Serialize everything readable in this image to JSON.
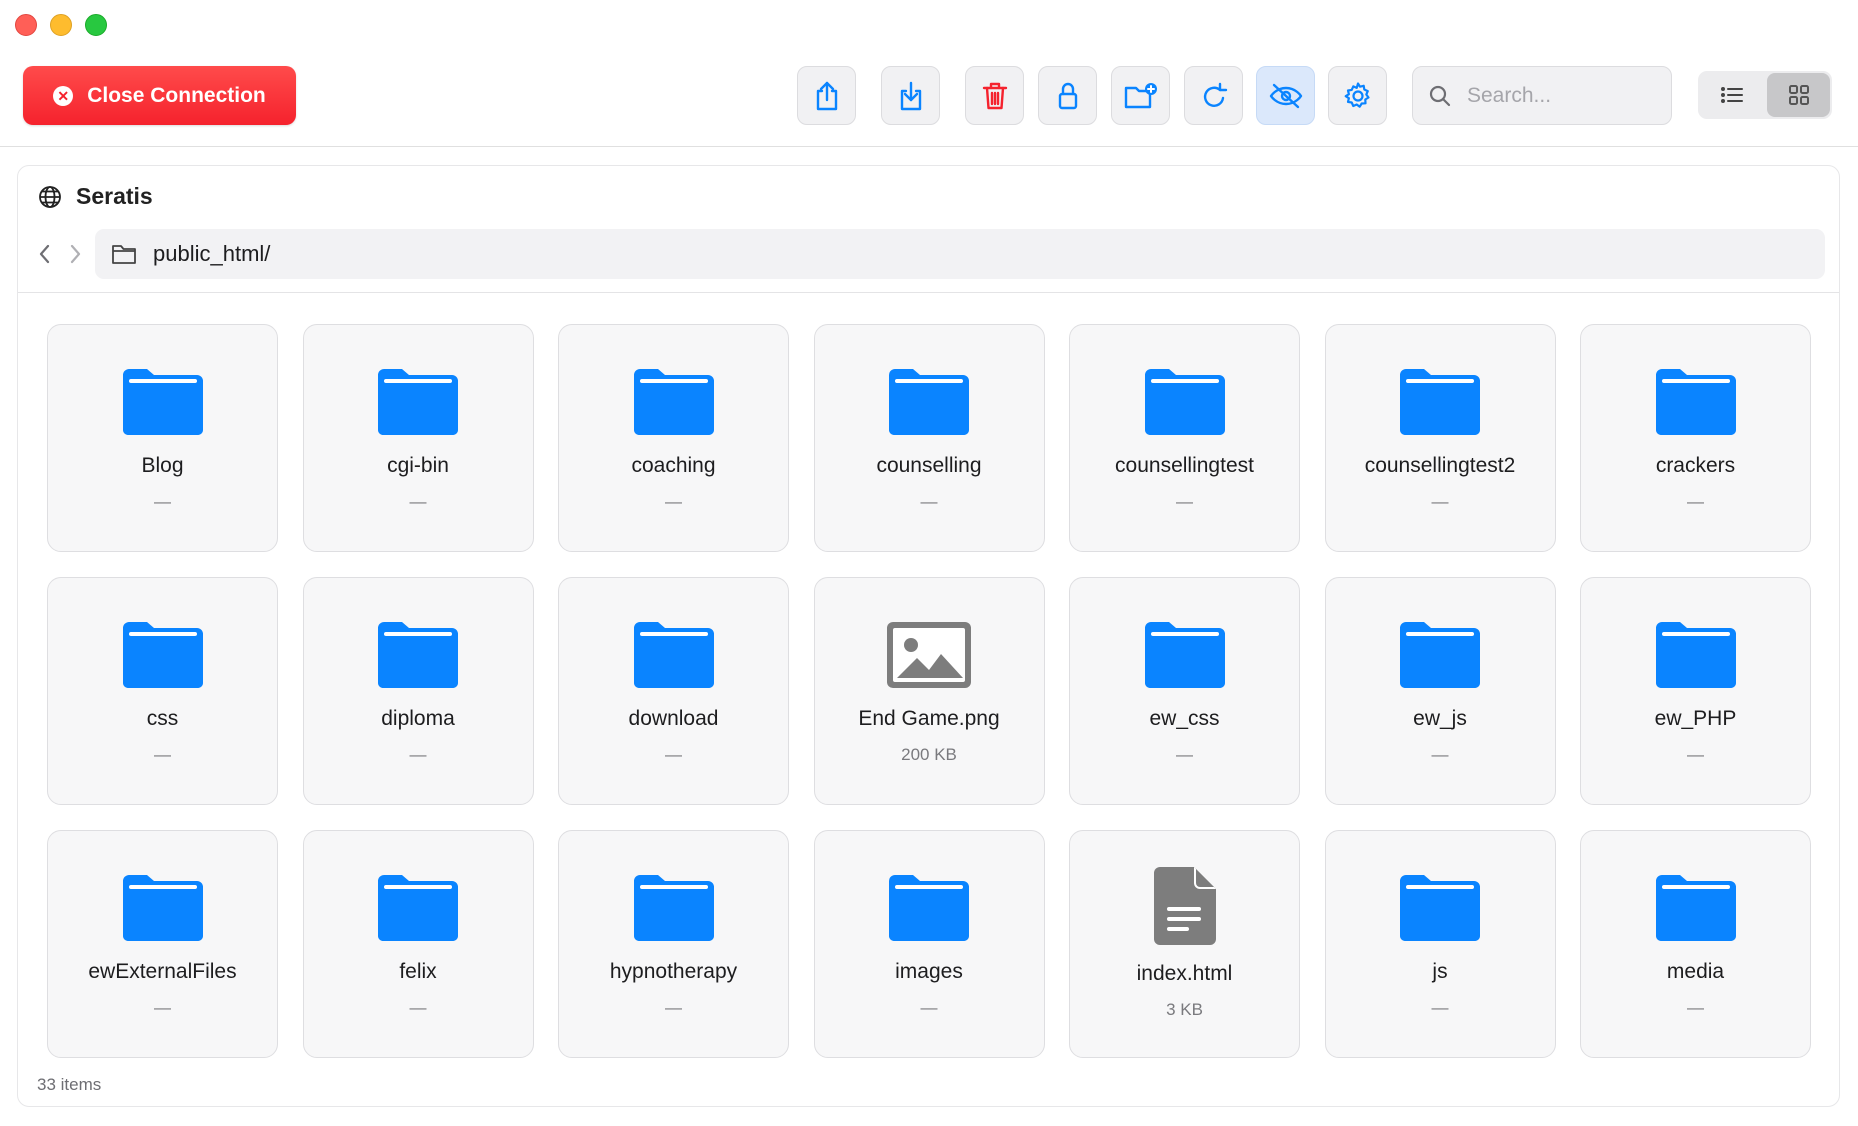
{
  "window": {
    "traffic_lights": [
      "close",
      "minimize",
      "zoom"
    ]
  },
  "toolbar": {
    "close_connection_label": "Close Connection",
    "buttons": [
      {
        "name": "upload-button",
        "icon": "share-upload-icon"
      },
      {
        "name": "download-button",
        "icon": "download-icon"
      },
      {
        "name": "delete-button",
        "icon": "trash-icon"
      },
      {
        "name": "permissions-button",
        "icon": "lock-icon"
      },
      {
        "name": "new-folder-button",
        "icon": "folder-plus-icon"
      },
      {
        "name": "refresh-button",
        "icon": "refresh-icon"
      },
      {
        "name": "toggle-hidden-button",
        "icon": "eye-slash-icon",
        "active": true
      },
      {
        "name": "settings-button",
        "icon": "gear-icon"
      }
    ],
    "search_placeholder": "Search...",
    "view_mode": "grid"
  },
  "server": {
    "name": "Seratis"
  },
  "path": {
    "current": "public_html/"
  },
  "items": [
    {
      "name": "Blog",
      "kind": "folder",
      "size": "—"
    },
    {
      "name": "cgi-bin",
      "kind": "folder",
      "size": "—"
    },
    {
      "name": "coaching",
      "kind": "folder",
      "size": "—"
    },
    {
      "name": "counselling",
      "kind": "folder",
      "size": "—"
    },
    {
      "name": "counsellingtest",
      "kind": "folder",
      "size": "—"
    },
    {
      "name": "counsellingtest2",
      "kind": "folder",
      "size": "—"
    },
    {
      "name": "crackers",
      "kind": "folder",
      "size": "—"
    },
    {
      "name": "css",
      "kind": "folder",
      "size": "—"
    },
    {
      "name": "diploma",
      "kind": "folder",
      "size": "—"
    },
    {
      "name": "download",
      "kind": "folder",
      "size": "—"
    },
    {
      "name": "End Game.png",
      "kind": "image",
      "size": "200 KB"
    },
    {
      "name": "ew_css",
      "kind": "folder",
      "size": "—"
    },
    {
      "name": "ew_js",
      "kind": "folder",
      "size": "—"
    },
    {
      "name": "ew_PHP",
      "kind": "folder",
      "size": "—"
    },
    {
      "name": "ewExternalFiles",
      "kind": "folder",
      "size": "—"
    },
    {
      "name": "felix",
      "kind": "folder",
      "size": "—"
    },
    {
      "name": "hypnotherapy",
      "kind": "folder",
      "size": "—"
    },
    {
      "name": "images",
      "kind": "folder",
      "size": "—"
    },
    {
      "name": "index.html",
      "kind": "document",
      "size": "3 KB"
    },
    {
      "name": "js",
      "kind": "folder",
      "size": "—"
    },
    {
      "name": "media",
      "kind": "folder",
      "size": "—"
    }
  ],
  "footer": {
    "item_count": "33 items"
  },
  "colors": {
    "accent": "#0a84ff",
    "danger": "#f5222d",
    "file_gray": "#7d7d7d"
  }
}
